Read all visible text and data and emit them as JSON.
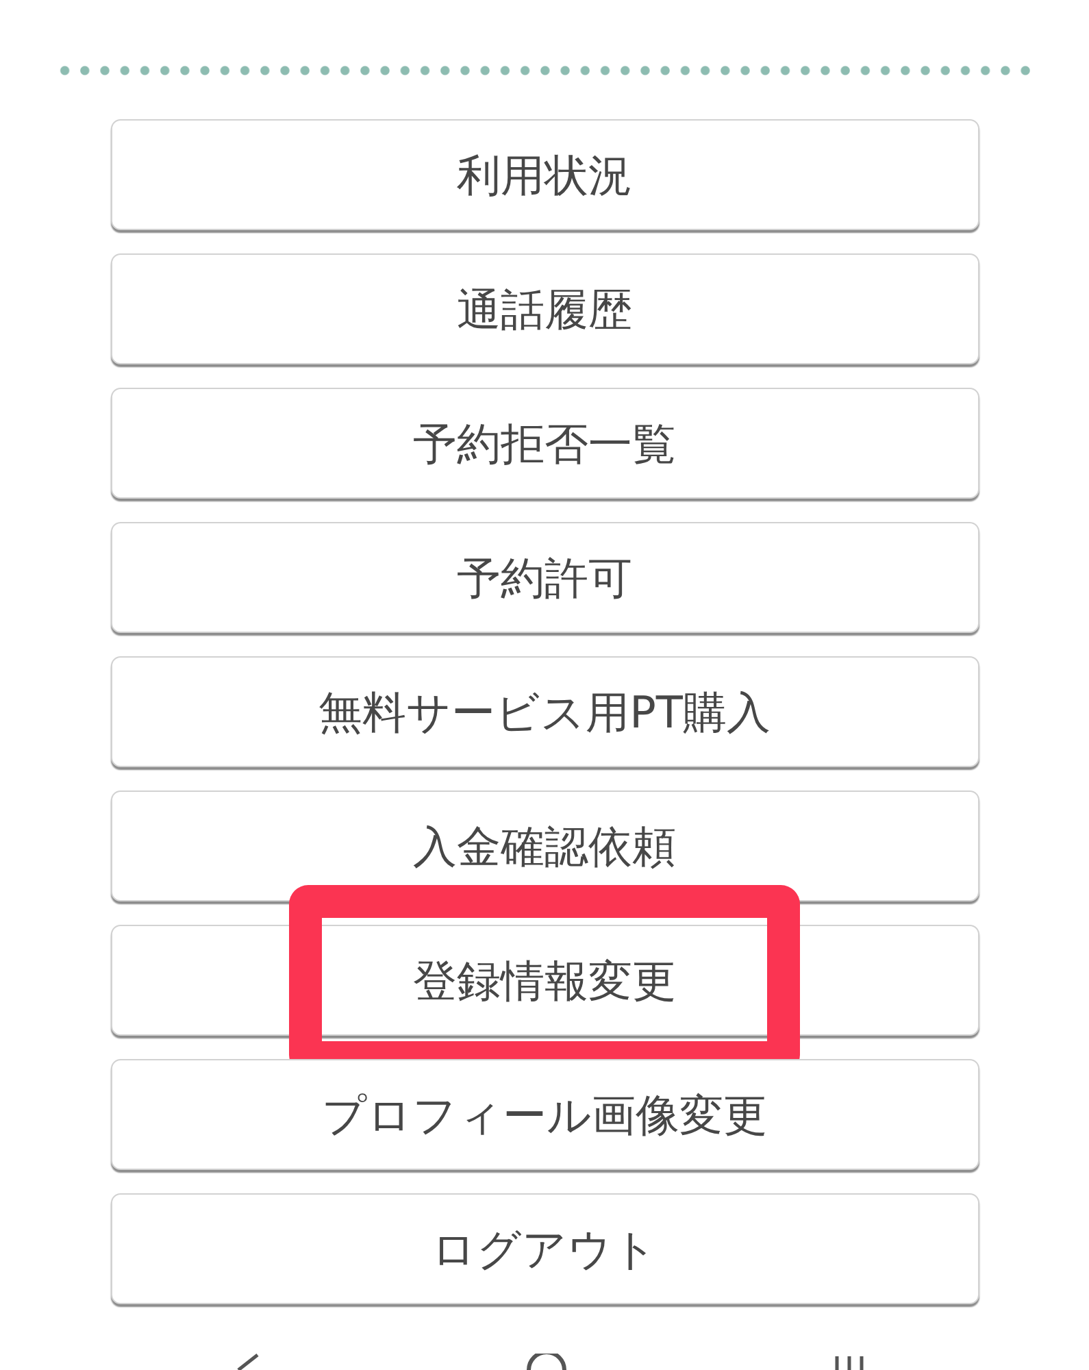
{
  "menu_items": [
    {
      "label": "利用状況",
      "highlighted": false
    },
    {
      "label": "通話履歴",
      "highlighted": false
    },
    {
      "label": "予約拒否一覧",
      "highlighted": false
    },
    {
      "label": "予約許可",
      "highlighted": false
    },
    {
      "label": "無料サービス用PT購入",
      "highlighted": false
    },
    {
      "label": "入金確認依頼",
      "highlighted": false
    },
    {
      "label": "登録情報変更",
      "highlighted": true
    },
    {
      "label": "プロフィール画像変更",
      "highlighted": false
    },
    {
      "label": "ログアウト",
      "highlighted": false
    }
  ]
}
